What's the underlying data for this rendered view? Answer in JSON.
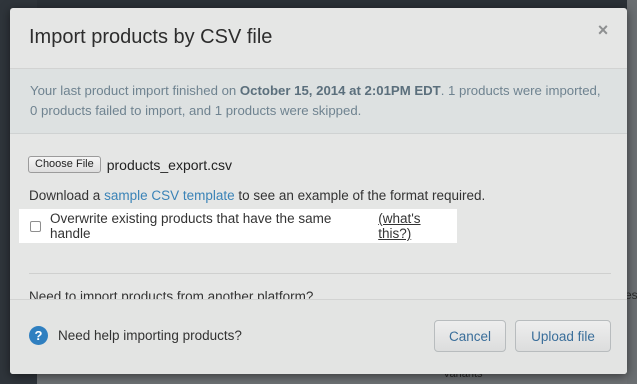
{
  "modal": {
    "title": "Import products by CSV file",
    "close_glyph": "×",
    "close_icon": "close-icon"
  },
  "notice": {
    "prefix": "Your last product import finished on ",
    "date": "October 15, 2014 at 2:01PM EDT",
    "suffix": ". 1 products were imported, 0 products failed to import, and 1 products were skipped."
  },
  "file": {
    "choose_label": "Choose File",
    "file_name": "products_export.csv"
  },
  "download": {
    "prefix": "Download a ",
    "link": "sample CSV template",
    "suffix": " to see an example of the format required."
  },
  "overwrite": {
    "label": "Overwrite existing products that have the same handle",
    "link": "(what's this?)",
    "checked": false
  },
  "platform_link": "Need to import products from another platform?",
  "footer": {
    "help_glyph": "?",
    "help_icon": "question-icon",
    "help_text": "Need help importing products?",
    "cancel_label": "Cancel",
    "upload_label": "Upload file"
  },
  "background": {
    "partial_text_right": "es",
    "partial_text_bottom": "Variants"
  },
  "colors": {
    "link_blue": "#3a83b7",
    "help_blue": "#2f7fc0",
    "notice_text": "#6f8390"
  }
}
